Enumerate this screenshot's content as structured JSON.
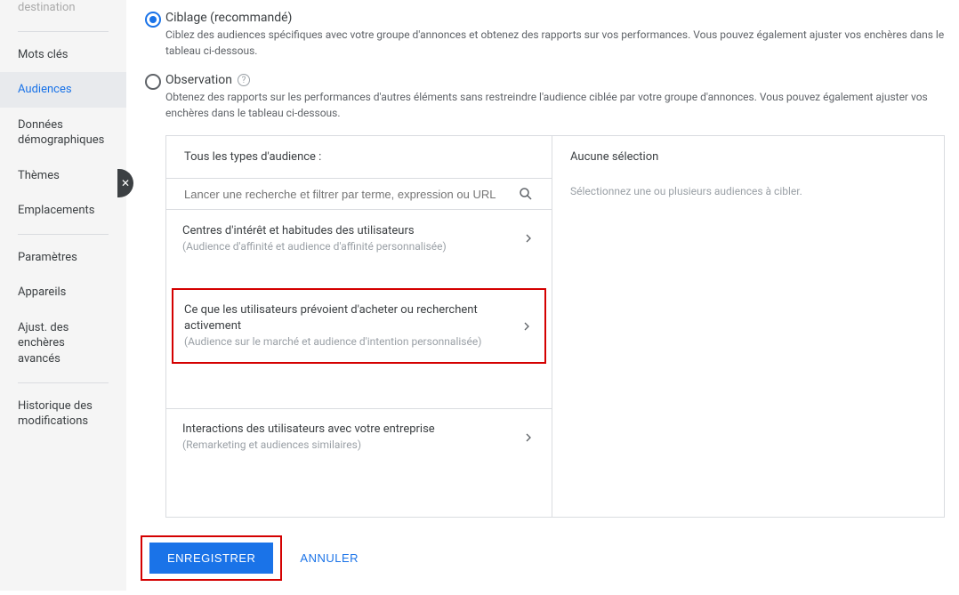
{
  "sidebar": {
    "items": [
      {
        "label": "destination"
      },
      {
        "label": "Mots clés"
      },
      {
        "label": "Audiences"
      },
      {
        "label": "Données démographiques"
      },
      {
        "label": "Thèmes"
      },
      {
        "label": "Emplacements"
      },
      {
        "label": "Paramètres"
      },
      {
        "label": "Appareils"
      },
      {
        "label": "Ajust. des enchères avancés"
      },
      {
        "label": "Historique des modifications"
      }
    ]
  },
  "options": {
    "targeting": {
      "title": "Ciblage (recommandé)",
      "desc": "Ciblez des audiences spécifiques avec votre groupe d'annonces et obtenez des rapports sur vos performances. Vous pouvez également ajuster vos enchères dans le tableau ci-dessous."
    },
    "observation": {
      "title": "Observation",
      "desc": "Obtenez des rapports sur les performances d'autres éléments sans restreindre l'audience ciblée par votre groupe d'annonces. Vous pouvez également ajuster vos enchères dans le tableau ci-dessous."
    }
  },
  "panel": {
    "left_header": "Tous les types d'audience :",
    "search_placeholder": "Lancer une recherche et filtrer par terme, expression ou URL",
    "right_header": "Aucune sélection",
    "right_hint": "Sélectionnez une ou plusieurs audiences à cibler."
  },
  "categories": [
    {
      "title": "Centres d'intérêt et habitudes des utilisateurs",
      "sub": "(Audience d'affinité et audience d'affinité personnalisée)"
    },
    {
      "title": "Ce que les utilisateurs prévoient d'acheter ou recherchent activement",
      "sub": "(Audience sur le marché et audience d'intention personnalisée)"
    },
    {
      "title": "Interactions des utilisateurs avec votre entreprise",
      "sub": "(Remarketing et audiences similaires)"
    }
  ],
  "actions": {
    "save": "ENREGISTRER",
    "cancel": "ANNULER"
  }
}
